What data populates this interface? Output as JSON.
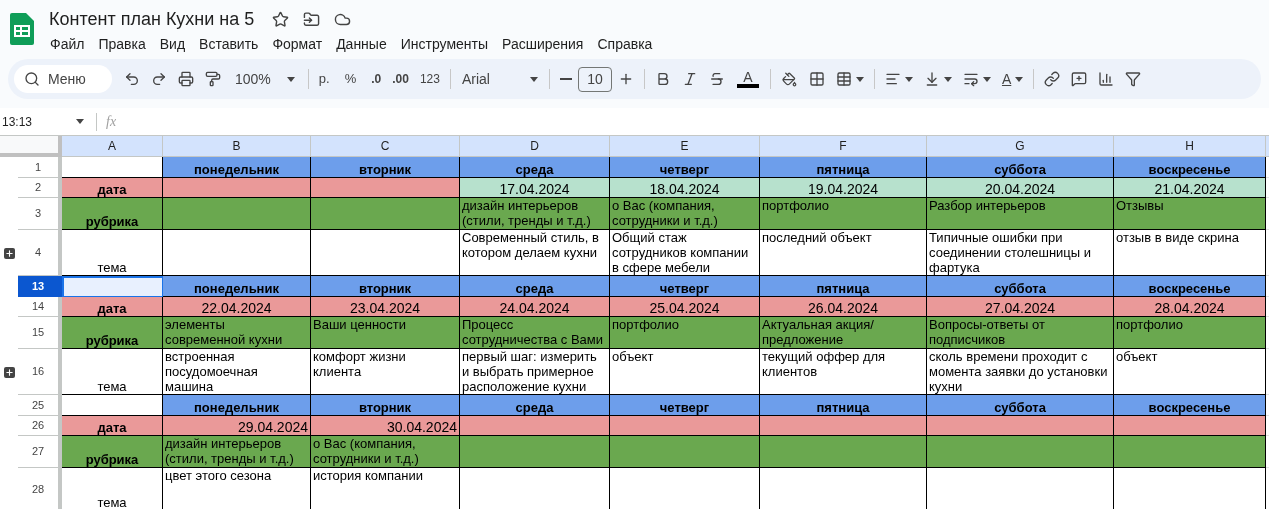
{
  "doc": {
    "title": "Контент план Кухни на 5"
  },
  "menu": [
    "Файл",
    "Правка",
    "Вид",
    "Вставить",
    "Формат",
    "Данные",
    "Инструменты",
    "Расширения",
    "Справка"
  ],
  "toolbar": {
    "search": "Меню",
    "zoom": "100%",
    "currency": "р.",
    "percent": "%",
    "dec_less": ".0",
    "dec_more": ".00",
    "number_format": "123",
    "font": "Arial",
    "font_size": "10",
    "text_color": "A",
    "text_rotation": "A"
  },
  "formula_bar": {
    "name_box": "13:13",
    "fx": "fx"
  },
  "columns": [
    "A",
    "B",
    "C",
    "D",
    "E",
    "F",
    "G",
    "H"
  ],
  "rows": [
    {
      "num": "1",
      "kind": "day",
      "selected": false,
      "group_toggle": false,
      "cells": [
        {
          "text": ""
        },
        {
          "text": "понедельник"
        },
        {
          "text": "вторник"
        },
        {
          "text": "среда"
        },
        {
          "text": "четверг"
        },
        {
          "text": "пятница"
        },
        {
          "text": "суббота"
        },
        {
          "text": "воскресенье"
        }
      ]
    },
    {
      "num": "2",
      "kind": "date",
      "right_aligned": false,
      "selected": false,
      "group_toggle": false,
      "cells": [
        {
          "text": "дата",
          "color": "#ea9999"
        },
        {
          "text": "",
          "color": "#ea9999"
        },
        {
          "text": "",
          "color": "#ea9999"
        },
        {
          "text": "17.04.2024",
          "color": "#b7e1cd"
        },
        {
          "text": "18.04.2024",
          "color": "#b7e1cd"
        },
        {
          "text": "19.04.2024",
          "color": "#b7e1cd"
        },
        {
          "text": "20.04.2024",
          "color": "#b7e1cd"
        },
        {
          "text": "21.04.2024",
          "color": "#b7e1cd"
        }
      ]
    },
    {
      "num": "3",
      "kind": "rubric",
      "selected": false,
      "group_toggle": false,
      "cells": [
        {
          "text": "рубрика"
        },
        {
          "text": ""
        },
        {
          "text": ""
        },
        {
          "text": "дизайн интерьеров (стили, тренды и т.д.)"
        },
        {
          "text": "о Вас (компания, сотрудники и т.д.)"
        },
        {
          "text": "портфолио"
        },
        {
          "text": "Разбор интерьеров"
        },
        {
          "text": "Отзывы"
        }
      ]
    },
    {
      "num": "4",
      "kind": "topic",
      "selected": false,
      "group_toggle": true,
      "cells": [
        {
          "text": "тема"
        },
        {
          "text": ""
        },
        {
          "text": ""
        },
        {
          "text": "Современный стиль, в котором делаем кухни"
        },
        {
          "text": "Общий стаж сотрудников компании в сфере мебели"
        },
        {
          "text": "последний объект"
        },
        {
          "text": "Типичные ошибки при соединении столешницы и фартука"
        },
        {
          "text": "отзыв в виде скрина"
        }
      ]
    },
    {
      "num": "13",
      "kind": "day",
      "selected": true,
      "group_toggle": false,
      "cells": [
        {
          "text": ""
        },
        {
          "text": "понедельник"
        },
        {
          "text": "вторник"
        },
        {
          "text": "среда"
        },
        {
          "text": "четверг"
        },
        {
          "text": "пятница"
        },
        {
          "text": "суббота"
        },
        {
          "text": "воскресенье"
        }
      ]
    },
    {
      "num": "14",
      "kind": "date",
      "right_aligned": false,
      "selected": false,
      "group_toggle": false,
      "cells": [
        {
          "text": "дата",
          "color": "#ea9999"
        },
        {
          "text": "22.04.2024",
          "color": "#ea9999"
        },
        {
          "text": "23.04.2024",
          "color": "#ea9999"
        },
        {
          "text": "24.04.2024",
          "color": "#ea9999"
        },
        {
          "text": "25.04.2024",
          "color": "#ea9999"
        },
        {
          "text": "26.04.2024",
          "color": "#ea9999"
        },
        {
          "text": "27.04.2024",
          "color": "#ea9999"
        },
        {
          "text": "28.04.2024",
          "color": "#ea9999"
        }
      ]
    },
    {
      "num": "15",
      "kind": "rubric",
      "selected": false,
      "group_toggle": false,
      "cells": [
        {
          "text": "рубрика"
        },
        {
          "text": "элементы современной кухни"
        },
        {
          "text": "Ваши ценности"
        },
        {
          "text": "Процесс сотрудничества с Вами"
        },
        {
          "text": "портфолио"
        },
        {
          "text": "Актуальная акция/предложение"
        },
        {
          "text": "Вопросы-ответы от подписчиков"
        },
        {
          "text": "портфолио"
        }
      ]
    },
    {
      "num": "16",
      "kind": "topic",
      "selected": false,
      "group_toggle": true,
      "cells": [
        {
          "text": "тема"
        },
        {
          "text": "встроенная посудомоечная машина"
        },
        {
          "text": "комфорт жизни клиента"
        },
        {
          "text": "первый шаг: измерить и выбрать примерное расположение кухни"
        },
        {
          "text": "объект"
        },
        {
          "text": "текущий оффер для клиентов"
        },
        {
          "text": "сколь времени проходит с момента заявки до установки кухни"
        },
        {
          "text": "объект"
        }
      ]
    },
    {
      "num": "25",
      "kind": "day",
      "selected": false,
      "group_toggle": false,
      "cells": [
        {
          "text": ""
        },
        {
          "text": "понедельник"
        },
        {
          "text": "вторник"
        },
        {
          "text": "среда"
        },
        {
          "text": "четверг"
        },
        {
          "text": "пятница"
        },
        {
          "text": "суббота"
        },
        {
          "text": "воскресенье"
        }
      ]
    },
    {
      "num": "26",
      "kind": "date",
      "right_aligned": true,
      "selected": false,
      "group_toggle": false,
      "cells": [
        {
          "text": "дата",
          "color": "#ea9999"
        },
        {
          "text": "29.04.2024",
          "color": "#ea9999"
        },
        {
          "text": "30.04.2024",
          "color": "#ea9999"
        },
        {
          "text": "",
          "color": "#ea9999"
        },
        {
          "text": "",
          "color": "#ea9999"
        },
        {
          "text": "",
          "color": "#ea9999"
        },
        {
          "text": "",
          "color": "#ea9999"
        },
        {
          "text": "",
          "color": "#ea9999"
        }
      ]
    },
    {
      "num": "27",
      "kind": "rubric",
      "selected": false,
      "group_toggle": false,
      "cells": [
        {
          "text": "рубрика"
        },
        {
          "text": "дизайн интерьеров (стили, тренды и т.д.)"
        },
        {
          "text": "о Вас (компания, сотрудники и т.д.)"
        },
        {
          "text": ""
        },
        {
          "text": ""
        },
        {
          "text": ""
        },
        {
          "text": ""
        },
        {
          "text": ""
        }
      ]
    },
    {
      "num": "28",
      "kind": "topic",
      "selected": false,
      "group_toggle": false,
      "cells": [
        {
          "text": "тема"
        },
        {
          "text": "цвет этого сезона"
        },
        {
          "text": "история компании"
        },
        {
          "text": ""
        },
        {
          "text": ""
        },
        {
          "text": ""
        },
        {
          "text": ""
        },
        {
          "text": ""
        }
      ]
    }
  ]
}
